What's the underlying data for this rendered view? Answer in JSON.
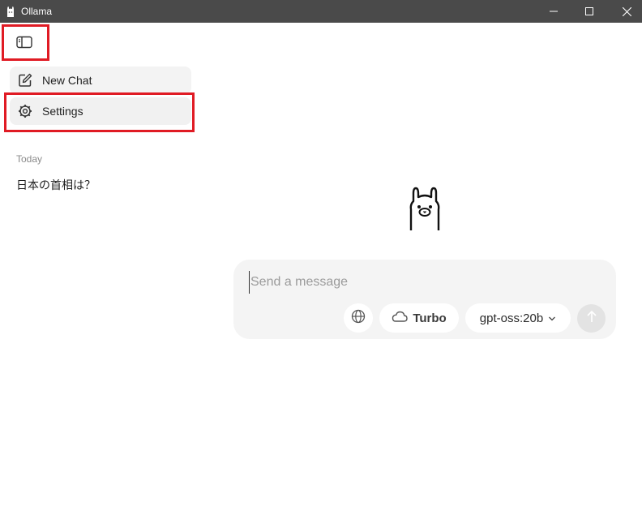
{
  "window": {
    "title": "Ollama"
  },
  "sidebar": {
    "toggle_icon": "sidebar-panel-icon",
    "items": [
      {
        "label": "New Chat",
        "icon": "edit-square-icon"
      },
      {
        "label": "Settings",
        "icon": "gear-icon"
      }
    ],
    "history_section": "Today",
    "history": [
      {
        "title": "日本の首相は？"
      }
    ]
  },
  "main": {
    "logo_icon": "ollama-llama-icon",
    "composer": {
      "placeholder": "Send a message",
      "value": "",
      "web_search_icon": "globe-icon",
      "turbo_label": "Turbo",
      "turbo_icon": "cloud-icon",
      "model_label": "gpt-oss:20b",
      "model_dropdown_icon": "chevron-down-icon",
      "send_icon": "arrow-up-icon"
    }
  },
  "colors": {
    "titlebar": "#4a4a4a",
    "highlight_box": "#e01b24",
    "composer_bg": "#f4f4f4",
    "send_disabled": "#e3e3e3"
  }
}
